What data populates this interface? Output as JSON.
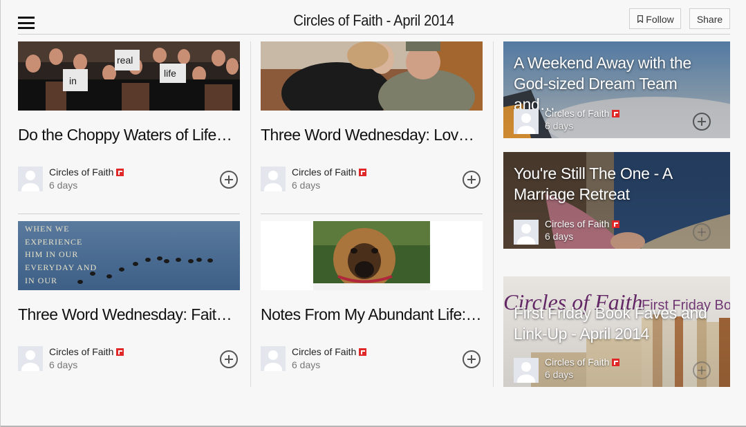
{
  "header": {
    "title": "Circles of Faith - April 2014",
    "follow_label": "Follow",
    "share_label": "Share"
  },
  "cards": [
    {
      "title": "Do the Choppy Waters of Life…",
      "author": "Circles of Faith",
      "age": "6 days",
      "image_words": [
        "in",
        "real",
        "life"
      ]
    },
    {
      "title": "Three Word Wednesday: Love is…",
      "author": "Circles of Faith",
      "age": "6 days"
    },
    {
      "title": "Three Word Wednesday: Faith ~…",
      "author": "Circles of Faith",
      "age": "6 days",
      "image_text": "WHEN WE EXPERIENCE HIM IN OUR EVERYDAY AND IN OUR"
    },
    {
      "title": "Notes From My Abundant Life:…",
      "author": "Circles of Faith",
      "age": "6 days"
    }
  ],
  "tiles": [
    {
      "title": "A Weekend Away with the God-sized Dream Team and…",
      "author": "Circles of Faith",
      "age": "6 days"
    },
    {
      "title": "You're Still The One - A Marriage Retreat",
      "author": "Circles of Faith",
      "age": "6 days"
    },
    {
      "title": "First Friday Book Faves and Link-Up - April 2014",
      "author": "Circles of Faith",
      "age": "6 days",
      "image_banner": "Circles of Faith",
      "image_banner_right": "First Friday Bo"
    }
  ],
  "colors": {
    "flipboard_red": "#e12828",
    "background": "#f7f7f7"
  }
}
